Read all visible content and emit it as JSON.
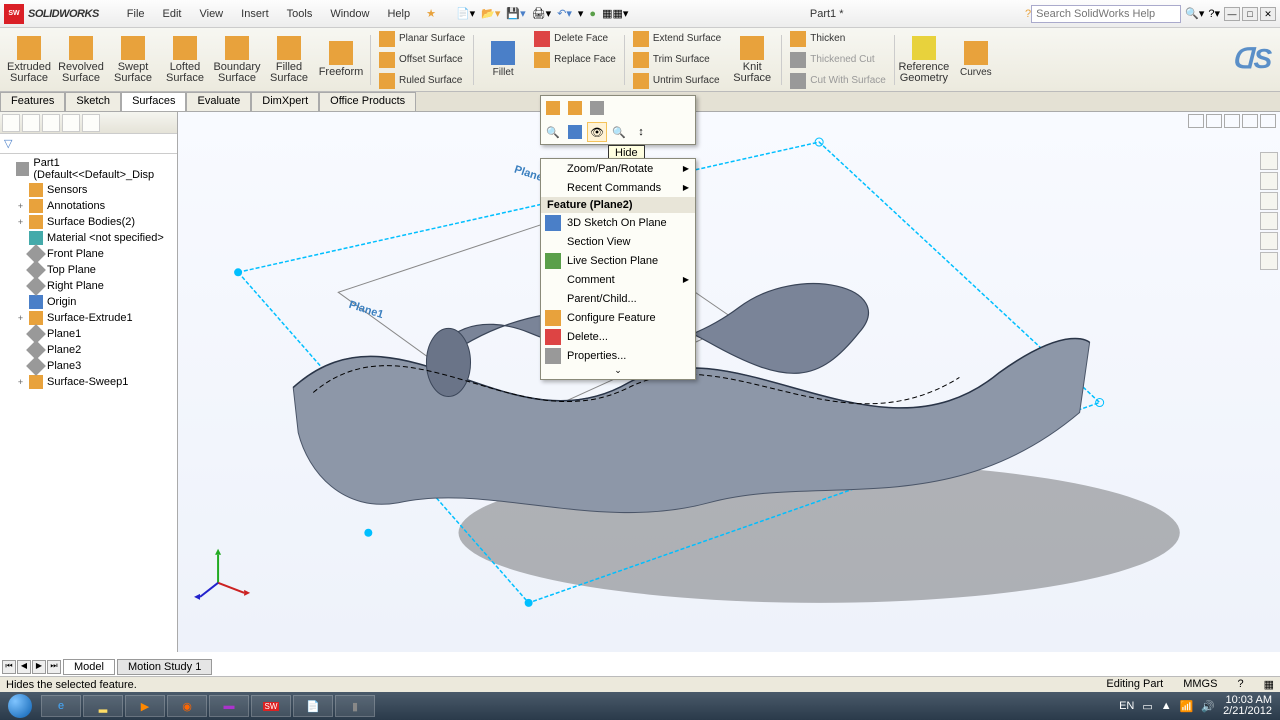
{
  "app": {
    "brand": "SOLIDWORKS",
    "title": "Part1 *"
  },
  "menus": [
    "File",
    "Edit",
    "View",
    "Insert",
    "Tools",
    "Window",
    "Help"
  ],
  "search": {
    "placeholder": "Search SolidWorks Help"
  },
  "ribbon": {
    "big": [
      {
        "l1": "Extruded",
        "l2": "Surface"
      },
      {
        "l1": "Revolved",
        "l2": "Surface"
      },
      {
        "l1": "Swept",
        "l2": "Surface"
      },
      {
        "l1": "Lofted",
        "l2": "Surface"
      },
      {
        "l1": "Boundary",
        "l2": "Surface"
      },
      {
        "l1": "Filled",
        "l2": "Surface"
      },
      {
        "l1": "Freeform",
        "l2": ""
      }
    ],
    "col1": [
      "Planar Surface",
      "Offset Surface",
      "Ruled Surface"
    ],
    "fillet": "Fillet",
    "col2": [
      "Delete Face",
      "Replace Face"
    ],
    "col3": [
      "Extend Surface",
      "Trim Surface",
      "Untrim Surface"
    ],
    "knit": {
      "l1": "Knit",
      "l2": "Surface"
    },
    "col4": [
      "Thicken",
      "Thickened Cut",
      "Cut With Surface"
    ],
    "refgeom": {
      "l1": "Reference",
      "l2": "Geometry"
    },
    "curves": "Curves"
  },
  "tabs": [
    "Features",
    "Sketch",
    "Surfaces",
    "Evaluate",
    "DimXpert",
    "Office Products"
  ],
  "activeTab": "Surfaces",
  "tree": {
    "root": "Part1 (Default<<Default>_Disp",
    "items": [
      {
        "exp": "",
        "t": "Sensors"
      },
      {
        "exp": "+",
        "t": "Annotations"
      },
      {
        "exp": "+",
        "t": "Surface Bodies(2)"
      },
      {
        "exp": "",
        "t": "Material <not specified>"
      },
      {
        "exp": "",
        "t": "Front Plane"
      },
      {
        "exp": "",
        "t": "Top Plane"
      },
      {
        "exp": "",
        "t": "Right Plane"
      },
      {
        "exp": "",
        "t": "Origin"
      },
      {
        "exp": "+",
        "t": "Surface-Extrude1"
      },
      {
        "exp": "",
        "t": "Plane1"
      },
      {
        "exp": "",
        "t": "Plane2"
      },
      {
        "exp": "",
        "t": "Plane3"
      },
      {
        "exp": "+",
        "t": "Surface-Sweep1"
      }
    ]
  },
  "planeLabels": {
    "p1": "Plane1",
    "p2": "Plane2"
  },
  "tooltip": "Hide",
  "ctx": {
    "zoom": "Zoom/Pan/Rotate",
    "recent": "Recent Commands",
    "hdr": "Feature (Plane2)",
    "items": [
      "3D Sketch On Plane",
      "Section View",
      "Live Section Plane",
      "Comment",
      "Parent/Child...",
      "Configure Feature",
      "Delete...",
      "Properties..."
    ]
  },
  "bottomTabs": {
    "model": "Model",
    "motion": "Motion Study 1"
  },
  "status": {
    "hint": "Hides the selected feature.",
    "mode": "Editing Part",
    "units": "MMGS"
  },
  "tray": {
    "lang": "EN",
    "time": "10:03 AM",
    "date": "2/21/2012"
  }
}
